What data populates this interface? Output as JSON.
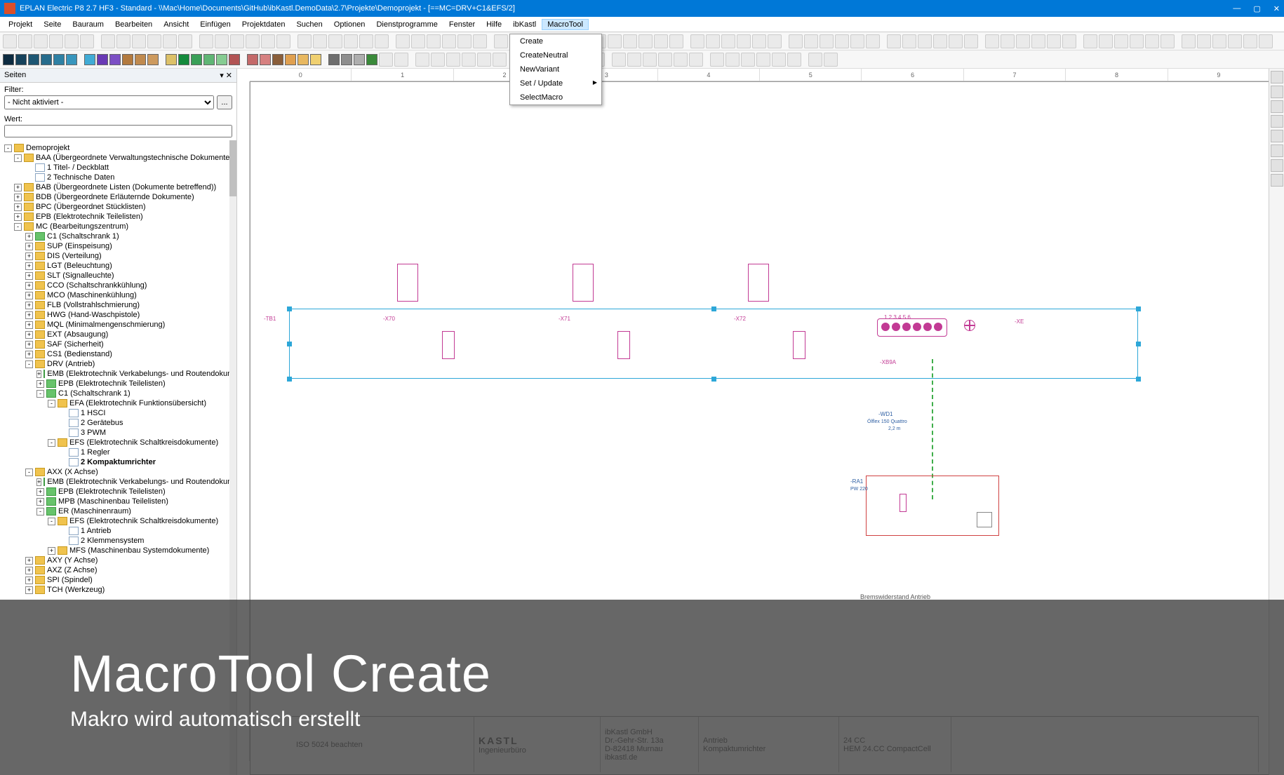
{
  "title": "EPLAN Electric P8 2.7 HF3 - Standard - \\\\Mac\\Home\\Documents\\GitHub\\ibKastl.DemoData\\2.7\\Projekte\\Demoprojekt - [==MC=DRV+C1&EFS/2]",
  "menu": [
    "Projekt",
    "Seite",
    "Bauraum",
    "Bearbeiten",
    "Ansicht",
    "Einfügen",
    "Projektdaten",
    "Suchen",
    "Optionen",
    "Dienstprogramme",
    "Fenster",
    "Hilfe",
    "ibKastl",
    "MacroTool"
  ],
  "dropdown": [
    "Create",
    "CreateNeutral",
    "NewVariant",
    "Set / Update",
    "SelectMacro"
  ],
  "sidebar": {
    "title": "Seiten",
    "filter_label": "Filter:",
    "filter_value": "- Nicht aktiviert -",
    "filter_btn": "...",
    "wert_label": "Wert:"
  },
  "tree": [
    {
      "lvl": 0,
      "exp": "-",
      "label": "Demoprojekt",
      "ico": "folder"
    },
    {
      "lvl": 1,
      "exp": "-",
      "label": "BAA (Übergeordnete Verwaltungstechnische Dokumente)",
      "ico": "folder"
    },
    {
      "lvl": 2,
      "exp": "",
      "label": "1 Titel- / Deckblatt",
      "ico": "doc"
    },
    {
      "lvl": 2,
      "exp": "",
      "label": "2 Technische Daten",
      "ico": "doc"
    },
    {
      "lvl": 1,
      "exp": "+",
      "label": "BAB (Übergeordnete Listen (Dokumente betreffend))",
      "ico": "folder"
    },
    {
      "lvl": 1,
      "exp": "+",
      "label": "BDB (Übergeordnete Erläuternde Dokumente)",
      "ico": "folder"
    },
    {
      "lvl": 1,
      "exp": "+",
      "label": "BPC (Übergeordnet Stücklisten)",
      "ico": "folder"
    },
    {
      "lvl": 1,
      "exp": "+",
      "label": "EPB (Elektrotechnik Teilelisten)",
      "ico": "folder"
    },
    {
      "lvl": 1,
      "exp": "-",
      "label": "MC (Bearbeitungszentrum)",
      "ico": "folder"
    },
    {
      "lvl": 2,
      "exp": "+",
      "label": "C1 (Schaltschrank 1)",
      "ico": "green"
    },
    {
      "lvl": 2,
      "exp": "+",
      "label": "SUP (Einspeisung)",
      "ico": "folder"
    },
    {
      "lvl": 2,
      "exp": "+",
      "label": "DIS (Verteilung)",
      "ico": "folder"
    },
    {
      "lvl": 2,
      "exp": "+",
      "label": "LGT (Beleuchtung)",
      "ico": "folder"
    },
    {
      "lvl": 2,
      "exp": "+",
      "label": "SLT (Signalleuchte)",
      "ico": "folder"
    },
    {
      "lvl": 2,
      "exp": "+",
      "label": "CCO (Schaltschrankkühlung)",
      "ico": "folder"
    },
    {
      "lvl": 2,
      "exp": "+",
      "label": "MCO (Maschinenkühlung)",
      "ico": "folder"
    },
    {
      "lvl": 2,
      "exp": "+",
      "label": "FLB (Vollstrahlschmierung)",
      "ico": "folder"
    },
    {
      "lvl": 2,
      "exp": "+",
      "label": "HWG (Hand-Waschpistole)",
      "ico": "folder"
    },
    {
      "lvl": 2,
      "exp": "+",
      "label": "MQL (Minimalmengenschmierung)",
      "ico": "folder"
    },
    {
      "lvl": 2,
      "exp": "+",
      "label": "EXT (Absaugung)",
      "ico": "folder"
    },
    {
      "lvl": 2,
      "exp": "+",
      "label": "SAF (Sicherheit)",
      "ico": "folder"
    },
    {
      "lvl": 2,
      "exp": "+",
      "label": "CS1 (Bedienstand)",
      "ico": "folder"
    },
    {
      "lvl": 2,
      "exp": "-",
      "label": "DRV (Antrieb)",
      "ico": "folder"
    },
    {
      "lvl": 3,
      "exp": "+",
      "label": "EMB (Elektrotechnik Verkabelungs- und Routendokumente)",
      "ico": "green"
    },
    {
      "lvl": 3,
      "exp": "+",
      "label": "EPB (Elektrotechnik Teilelisten)",
      "ico": "green"
    },
    {
      "lvl": 3,
      "exp": "-",
      "label": "C1 (Schaltschrank 1)",
      "ico": "green"
    },
    {
      "lvl": 4,
      "exp": "-",
      "label": "EFA (Elektrotechnik Funktionsübersicht)",
      "ico": "folder"
    },
    {
      "lvl": 5,
      "exp": "",
      "label": "1 HSCI",
      "ico": "doc"
    },
    {
      "lvl": 5,
      "exp": "",
      "label": "2 Gerätebus",
      "ico": "doc"
    },
    {
      "lvl": 5,
      "exp": "",
      "label": "3 PWM",
      "ico": "doc"
    },
    {
      "lvl": 4,
      "exp": "-",
      "label": "EFS (Elektrotechnik Schaltkreisdokumente)",
      "ico": "folder"
    },
    {
      "lvl": 5,
      "exp": "",
      "label": "1 Regler",
      "ico": "doc"
    },
    {
      "lvl": 5,
      "exp": "",
      "label": "2 Kompaktumrichter",
      "ico": "doc",
      "bold": true
    },
    {
      "lvl": 2,
      "exp": "-",
      "label": "AXX (X Achse)",
      "ico": "folder"
    },
    {
      "lvl": 3,
      "exp": "+",
      "label": "EMB (Elektrotechnik Verkabelungs- und Routendokumente)",
      "ico": "green"
    },
    {
      "lvl": 3,
      "exp": "+",
      "label": "EPB (Elektrotechnik Teilelisten)",
      "ico": "green"
    },
    {
      "lvl": 3,
      "exp": "+",
      "label": "MPB (Maschinenbau Teilelisten)",
      "ico": "green"
    },
    {
      "lvl": 3,
      "exp": "-",
      "label": "ER (Maschinenraum)",
      "ico": "green"
    },
    {
      "lvl": 4,
      "exp": "-",
      "label": "EFS (Elektrotechnik Schaltkreisdokumente)",
      "ico": "folder"
    },
    {
      "lvl": 5,
      "exp": "",
      "label": "1 Antrieb",
      "ico": "doc"
    },
    {
      "lvl": 5,
      "exp": "",
      "label": "2 Klemmensystem",
      "ico": "doc"
    },
    {
      "lvl": 4,
      "exp": "+",
      "label": "MFS (Maschinenbau Systemdokumente)",
      "ico": "folder"
    },
    {
      "lvl": 2,
      "exp": "+",
      "label": "AXY (Y Achse)",
      "ico": "folder"
    },
    {
      "lvl": 2,
      "exp": "+",
      "label": "AXZ (Z Achse)",
      "ico": "folder"
    },
    {
      "lvl": 2,
      "exp": "+",
      "label": "SPI (Spindel)",
      "ico": "folder"
    },
    {
      "lvl": 2,
      "exp": "+",
      "label": "TCH (Werkzeug)",
      "ico": "folder"
    }
  ],
  "canvas": {
    "tb1": "-TB1",
    "x70": "-X70",
    "x71": "-X71",
    "x72": "-X72",
    "xe": "-XE",
    "xb9a": "-XB9A",
    "wd1": "-WD1",
    "cable": "Ölflex 150 Quattro",
    "length": "2,2 m",
    "ra1": "-RA1",
    "pw": "PW 220",
    "bw": "Bremswiderstand Antrieb",
    "pins": "1   2   3   4   5   6"
  },
  "titleblock": {
    "company": "ibKastl GmbH",
    "addr": "Dr.-Gehr-Str. 13a",
    "plz": "D-82418  Murnau",
    "web": "ibkastl.de",
    "logo": "KASTL",
    "sublogo": "Ingenieurbüro",
    "t1": "Antrieb",
    "t2": "Kompaktumrichter",
    "iso": "ISO 5024 beachten",
    "dev": "HEM 24.CC CompactCell",
    "pj": "24 CC"
  },
  "overlay": {
    "h1": "MacroTool Create",
    "h2": "Makro wird automatisch erstellt"
  },
  "color_squares": [
    "#0d2b40",
    "#16425b",
    "#1e5773",
    "#276c8c",
    "#2f81a4",
    "#3896bd",
    "#40abd5",
    "#693ab5",
    "#7c4fc4",
    "#b37a3e",
    "#c08a4e",
    "#cd9a5e",
    "#ddc168",
    "#148a3b",
    "#3aa058",
    "#60b675",
    "#86cc92",
    "#b25454",
    "#c46a6a",
    "#d68080",
    "#8a5e3a",
    "#e0a050",
    "#e8b860",
    "#f0d070",
    "#6e6e6e",
    "#8e8e8e",
    "#aeaeae",
    "#3a8a3a"
  ]
}
